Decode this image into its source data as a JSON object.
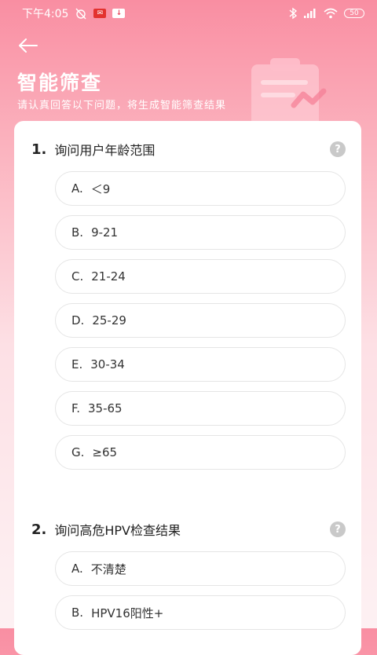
{
  "status_bar": {
    "time": "下午4:05",
    "battery": "50"
  },
  "header": {
    "title": "智能筛查",
    "subtitle": "请认真回答以下问题，将生成智能筛查结果"
  },
  "questions": [
    {
      "number": "1.",
      "text": "询问用户年龄范围",
      "help": "?",
      "options": [
        {
          "letter": "A.",
          "text": "＜9"
        },
        {
          "letter": "B.",
          "text": "9-21"
        },
        {
          "letter": "C.",
          "text": "21-24"
        },
        {
          "letter": "D.",
          "text": "25-29"
        },
        {
          "letter": "E.",
          "text": "30-34"
        },
        {
          "letter": "F.",
          "text": "35-65"
        },
        {
          "letter": "G.",
          "text": "≥65"
        }
      ]
    },
    {
      "number": "2.",
      "text": "询问高危HPV检查结果",
      "help": "?",
      "options": [
        {
          "letter": "A.",
          "text": "不清楚"
        },
        {
          "letter": "B.",
          "text": "HPV16阳性+"
        }
      ]
    }
  ],
  "colors": {
    "accent": "#f98ea2",
    "help_icon": "#c9c9c9"
  }
}
